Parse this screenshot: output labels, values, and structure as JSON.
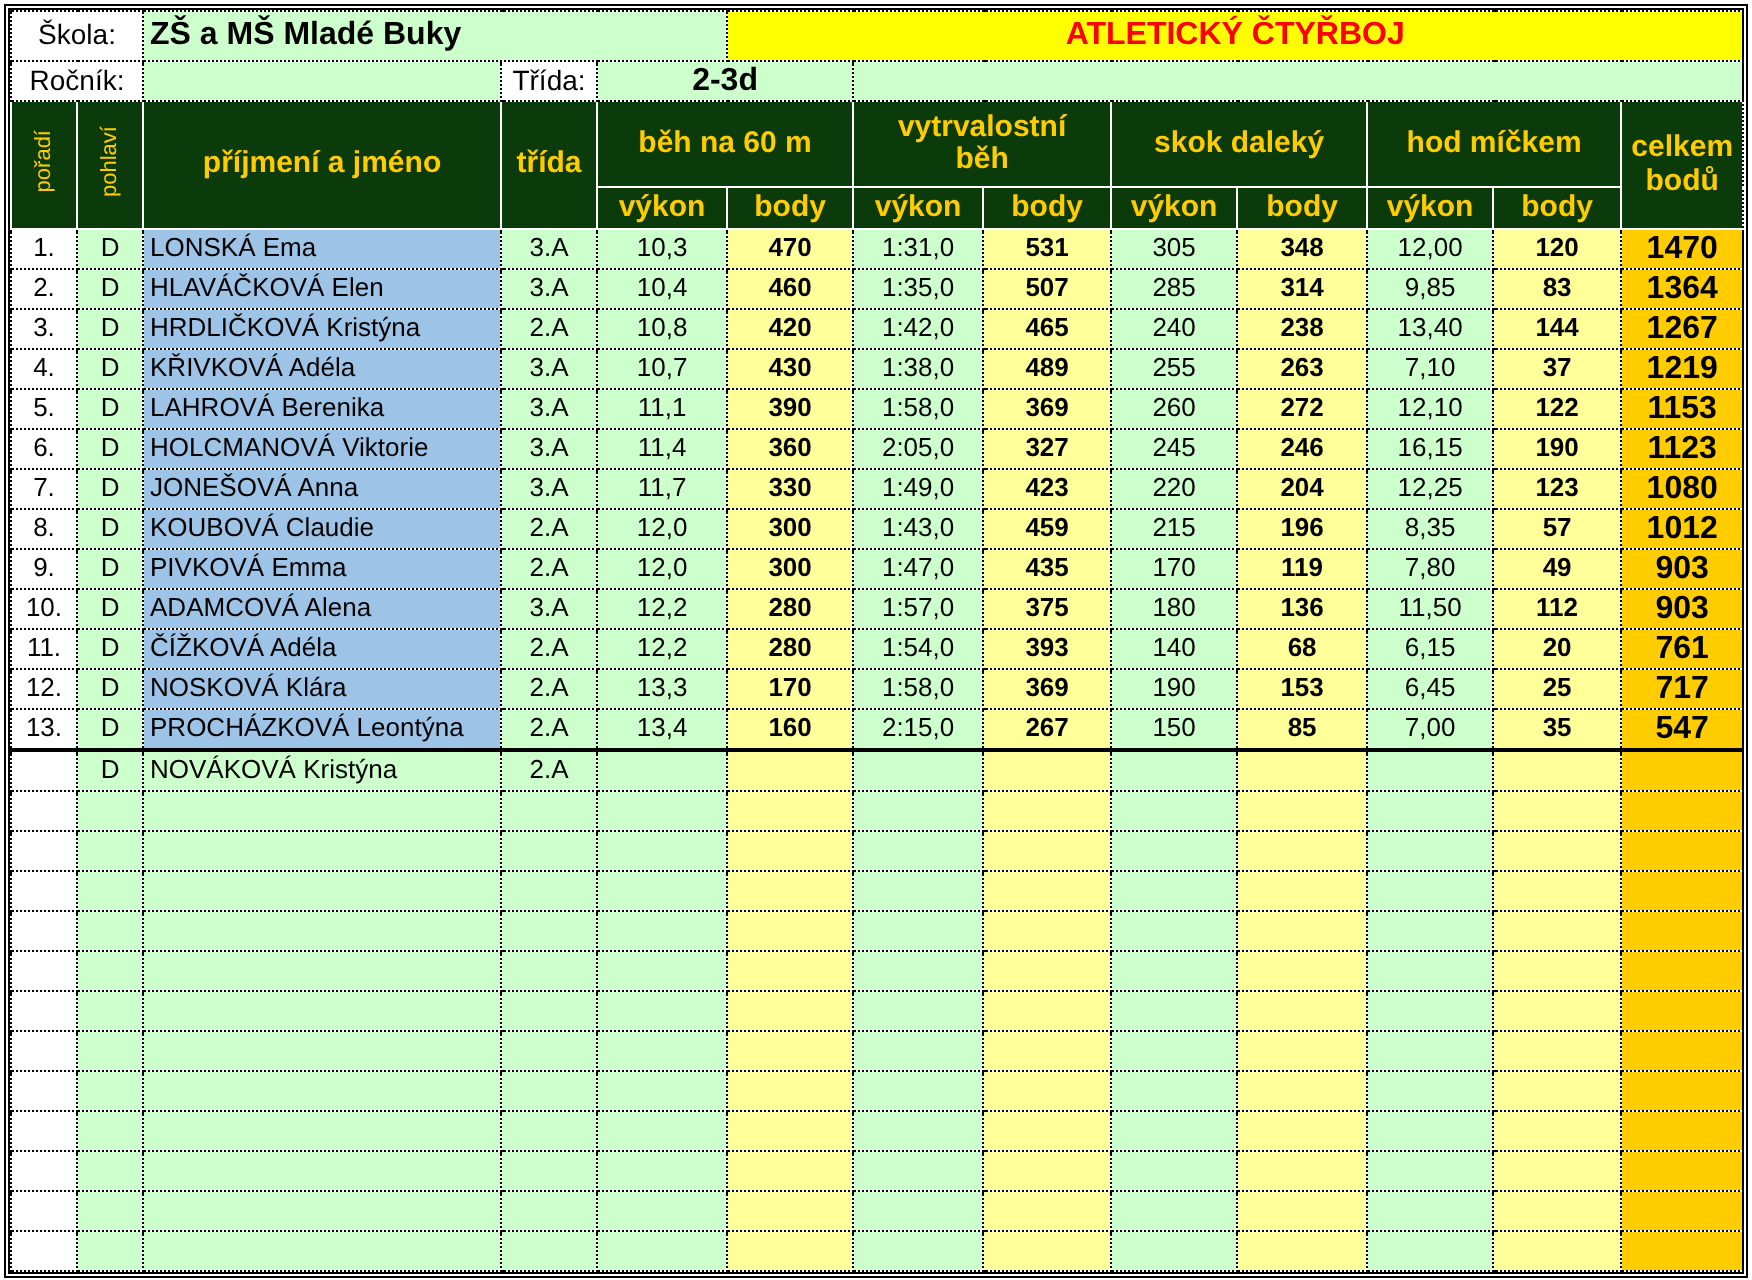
{
  "school": {
    "label": "Škola:",
    "value": "ZŠ a MŠ Mladé Buky"
  },
  "title": "ATLETICKÝ ČTYŘBOJ",
  "grade": {
    "label": "Ročník:"
  },
  "class_group": {
    "label": "Třída:",
    "value": "2-3d"
  },
  "header": {
    "rank": "pořadí",
    "sex": "pohlaví",
    "name": "příjmení a jméno",
    "class": "třída",
    "events": [
      {
        "name": "běh na 60 m",
        "performance": "výkon",
        "points": "body"
      },
      {
        "name": "vytrvalostní běh",
        "performance": "výkon",
        "points": "body"
      },
      {
        "name": "skok daleký",
        "performance": "výkon",
        "points": "body"
      },
      {
        "name": "hod míčkem",
        "performance": "výkon",
        "points": "body"
      }
    ],
    "total": "celkem bodů"
  },
  "rows": [
    {
      "ranked": true,
      "rank": "1.",
      "sex": "D",
      "name": "LONSKÁ Ema",
      "class": "3.A",
      "events": [
        {
          "performance": "10,3",
          "points": "470"
        },
        {
          "performance": "1:31,0",
          "points": "531"
        },
        {
          "performance": "305",
          "points": "348"
        },
        {
          "performance": "12,00",
          "points": "120"
        }
      ],
      "total": "1470"
    },
    {
      "ranked": true,
      "rank": "2.",
      "sex": "D",
      "name": "HLAVÁČKOVÁ Elen",
      "class": "3.A",
      "events": [
        {
          "performance": "10,4",
          "points": "460"
        },
        {
          "performance": "1:35,0",
          "points": "507"
        },
        {
          "performance": "285",
          "points": "314"
        },
        {
          "performance": "9,85",
          "points": "83"
        }
      ],
      "total": "1364"
    },
    {
      "ranked": true,
      "rank": "3.",
      "sex": "D",
      "name": "HRDLIČKOVÁ Kristýna",
      "class": "2.A",
      "events": [
        {
          "performance": "10,8",
          "points": "420"
        },
        {
          "performance": "1:42,0",
          "points": "465"
        },
        {
          "performance": "240",
          "points": "238"
        },
        {
          "performance": "13,40",
          "points": "144"
        }
      ],
      "total": "1267"
    },
    {
      "ranked": true,
      "rank": "4.",
      "sex": "D",
      "name": "KŘIVKOVÁ Adéla",
      "class": "3.A",
      "events": [
        {
          "performance": "10,7",
          "points": "430"
        },
        {
          "performance": "1:38,0",
          "points": "489"
        },
        {
          "performance": "255",
          "points": "263"
        },
        {
          "performance": "7,10",
          "points": "37"
        }
      ],
      "total": "1219"
    },
    {
      "ranked": true,
      "rank": "5.",
      "sex": "D",
      "name": "LAHROVÁ Berenika",
      "class": "3.A",
      "events": [
        {
          "performance": "11,1",
          "points": "390"
        },
        {
          "performance": "1:58,0",
          "points": "369"
        },
        {
          "performance": "260",
          "points": "272"
        },
        {
          "performance": "12,10",
          "points": "122"
        }
      ],
      "total": "1153"
    },
    {
      "ranked": true,
      "rank": "6.",
      "sex": "D",
      "name": "HOLCMANOVÁ Viktorie",
      "class": "3.A",
      "events": [
        {
          "performance": "11,4",
          "points": "360"
        },
        {
          "performance": "2:05,0",
          "points": "327"
        },
        {
          "performance": "245",
          "points": "246"
        },
        {
          "performance": "16,15",
          "points": "190"
        }
      ],
      "total": "1123"
    },
    {
      "ranked": true,
      "rank": "7.",
      "sex": "D",
      "name": "JONEŠOVÁ Anna",
      "class": "3.A",
      "events": [
        {
          "performance": "11,7",
          "points": "330"
        },
        {
          "performance": "1:49,0",
          "points": "423"
        },
        {
          "performance": "220",
          "points": "204"
        },
        {
          "performance": "12,25",
          "points": "123"
        }
      ],
      "total": "1080"
    },
    {
      "ranked": true,
      "rank": "8.",
      "sex": "D",
      "name": "KOUBOVÁ Claudie",
      "class": "2.A",
      "events": [
        {
          "performance": "12,0",
          "points": "300"
        },
        {
          "performance": "1:43,0",
          "points": "459"
        },
        {
          "performance": "215",
          "points": "196"
        },
        {
          "performance": "8,35",
          "points": "57"
        }
      ],
      "total": "1012"
    },
    {
      "ranked": true,
      "rank": "9.",
      "sex": "D",
      "name": "PIVKOVÁ Emma",
      "class": "2.A",
      "events": [
        {
          "performance": "12,0",
          "points": "300"
        },
        {
          "performance": "1:47,0",
          "points": "435"
        },
        {
          "performance": "170",
          "points": "119"
        },
        {
          "performance": "7,80",
          "points": "49"
        }
      ],
      "total": "903"
    },
    {
      "ranked": true,
      "rank": "10.",
      "sex": "D",
      "name": "ADAMCOVÁ Alena",
      "class": "3.A",
      "events": [
        {
          "performance": "12,2",
          "points": "280"
        },
        {
          "performance": "1:57,0",
          "points": "375"
        },
        {
          "performance": "180",
          "points": "136"
        },
        {
          "performance": "11,50",
          "points": "112"
        }
      ],
      "total": "903"
    },
    {
      "ranked": true,
      "rank": "11.",
      "sex": "D",
      "name": "ČÍŽKOVÁ Adéla",
      "class": "2.A",
      "events": [
        {
          "performance": "12,2",
          "points": "280"
        },
        {
          "performance": "1:54,0",
          "points": "393"
        },
        {
          "performance": "140",
          "points": "68"
        },
        {
          "performance": "6,15",
          "points": "20"
        }
      ],
      "total": "761"
    },
    {
      "ranked": true,
      "rank": "12.",
      "sex": "D",
      "name": "NOSKOVÁ Klára",
      "class": "2.A",
      "events": [
        {
          "performance": "13,3",
          "points": "170"
        },
        {
          "performance": "1:58,0",
          "points": "369"
        },
        {
          "performance": "190",
          "points": "153"
        },
        {
          "performance": "6,45",
          "points": "25"
        }
      ],
      "total": "717"
    },
    {
      "ranked": true,
      "rank": "13.",
      "sex": "D",
      "name": "PROCHÁZKOVÁ Leontýna",
      "class": "2.A",
      "events": [
        {
          "performance": "13,4",
          "points": "160"
        },
        {
          "performance": "2:15,0",
          "points": "267"
        },
        {
          "performance": "150",
          "points": "85"
        },
        {
          "performance": "7,00",
          "points": "35"
        }
      ],
      "total": "547"
    },
    {
      "ranked": false,
      "sex": "D",
      "name": "NOVÁKOVÁ Kristýna",
      "class": "2.A"
    }
  ]
}
